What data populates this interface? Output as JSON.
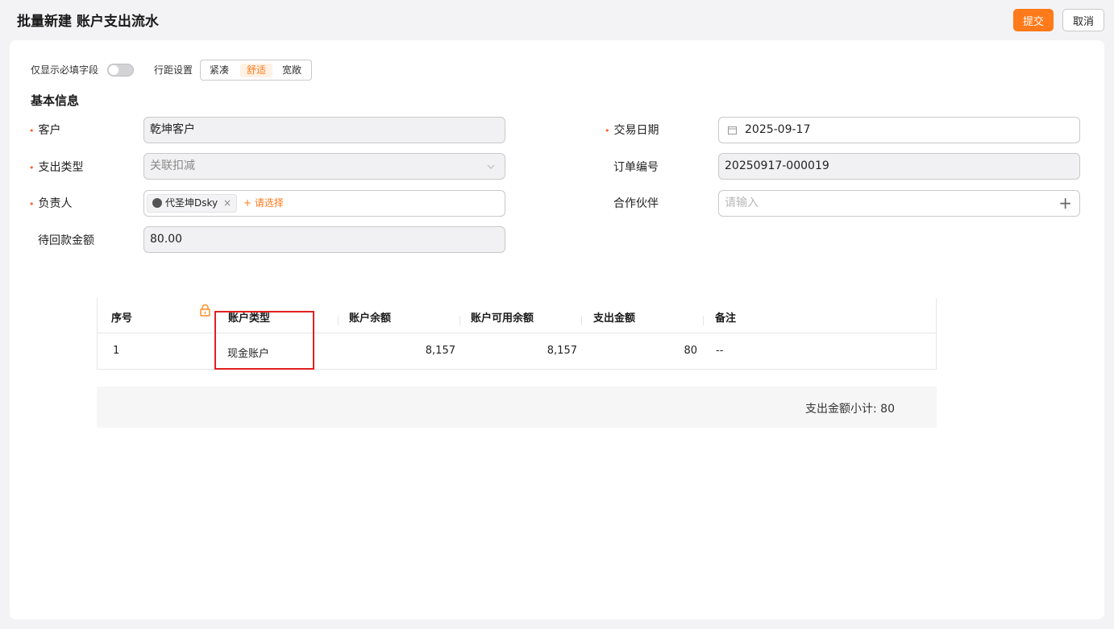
{
  "header": {
    "title": "批量新建 账户支出流水",
    "submit_label": "提交",
    "cancel_label": "取消",
    "accent_color": "#ff7a1a"
  },
  "toolbar": {
    "required_only_label": "仅显示必填字段",
    "required_only_on": false,
    "row_spacing_label": "行距设置",
    "row_spacing_options": [
      "紧凑",
      "舒适",
      "宽敞"
    ],
    "row_spacing_selected": "舒适"
  },
  "section": {
    "title": "基本信息"
  },
  "form": {
    "customer": {
      "label": "客户",
      "value": "乾坤客户",
      "required": true
    },
    "expense_type": {
      "label": "支出类型",
      "value": "关联扣减",
      "required": true
    },
    "owner": {
      "label": "负责人",
      "tag": "代圣坤Dsky",
      "tag_close": "×",
      "add_label": "+ 请选择",
      "required": true
    },
    "pending_amount": {
      "label": "待回款金额",
      "value": "80.00"
    },
    "trade_date": {
      "label": "交易日期",
      "value": "2025-09-17",
      "required": true
    },
    "order_no": {
      "label": "订单编号",
      "value": "20250917-000019"
    },
    "partner": {
      "label": "合作伙伴",
      "placeholder": "请输入",
      "add_icon": "+"
    }
  },
  "table": {
    "columns": [
      "序号",
      "账户类型",
      "账户余额",
      "账户可用余额",
      "支出金额",
      "备注"
    ],
    "rows": [
      {
        "index": "1",
        "account_type": "现金账户",
        "balance": "8,157",
        "available": "8,157",
        "amount": "80",
        "note": "--"
      }
    ]
  },
  "summary": {
    "text": "支出金额小计: 80"
  },
  "required_mark": "•"
}
